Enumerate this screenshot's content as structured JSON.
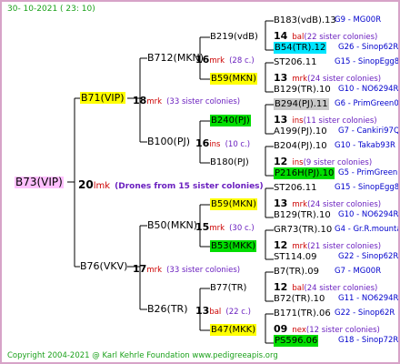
{
  "date": "30- 10-2021 ( 23: 10)",
  "copyright": "Copyright 2004-2021 @ Karl Kehrle Foundation   www.pedigreeapis.org",
  "colors": {
    "yellow": "#ffff00",
    "green": "#00dd00",
    "cyan": "#00e5ff",
    "gray": "#c8c8c8",
    "pink": "#ffc0ff",
    "lines": "#000000",
    "border": "#d7a3c8"
  },
  "root": {
    "name": "B73(VIP)",
    "num": "20",
    "mrk": "lmk",
    "colonies": "(Drones from 15 sister colonies)"
  },
  "gen1": [
    {
      "name": "B71(VIP)",
      "num": "18",
      "mrk": "mrk",
      "colonies": "(33 sister colonies)"
    },
    {
      "name": "B76(VKV)",
      "num": "17",
      "mrk": "mrk",
      "colonies": "(33 sister colonies)"
    }
  ],
  "gen2": [
    {
      "name": "B712(MKN)",
      "num": "16",
      "mrk": "mrk",
      "colonies": "(28 c.)"
    },
    {
      "name": "B100(PJ)",
      "num": "16",
      "mrk": "ins",
      "colonies": "(10 c.)"
    },
    {
      "name": "B50(MKN)",
      "num": "15",
      "mrk": "mrk",
      "colonies": "(30 c.)"
    },
    {
      "name": "B26(TR)",
      "num": "13",
      "mrk": "bal",
      "colonies": "(22 c.)"
    }
  ],
  "gen3": [
    {
      "name": "B219(vdB)"
    },
    {
      "name": "B59(MKN)"
    },
    {
      "name": "B240(PJ)"
    },
    {
      "name": "B180(PJ)"
    },
    {
      "name": "B59(MKN)"
    },
    {
      "name": "B53(MKK)"
    },
    {
      "name": "B77(TR)"
    },
    {
      "name": "B47(MKK)"
    }
  ],
  "gen4": [
    {
      "sire": "B183(vdB).13",
      "sire_code": "G9 - MG00R",
      "num": "14",
      "mrk": "bal",
      "colonies": "(22 sister colonies)",
      "dam": "B54(TR).12",
      "dam_code": "G26 - Sinop62R"
    },
    {
      "sire": "ST206.11",
      "sire_code": "G15 - SinopEgg86R",
      "num": "13",
      "mrk": "mrk",
      "colonies": "(24 sister colonies)",
      "dam": "B129(TR).10",
      "dam_code": "G10 - NO6294R"
    },
    {
      "sire": "B294(PJ).11",
      "sire_code": "G6 - PrimGreen00",
      "num": "13",
      "mrk": "ins",
      "colonies": "(11 sister colonies)",
      "dam": "A199(PJ).10",
      "dam_code": "G7 - Cankiri97Q"
    },
    {
      "sire": "B204(PJ).10",
      "sire_code": "G10 - Takab93R",
      "num": "12",
      "mrk": "ins",
      "colonies": "(9 sister colonies)",
      "dam": "P216H(PJ).10",
      "dam_code": "G5 - PrimGreen00"
    },
    {
      "sire": "ST206.11",
      "sire_code": "G15 - SinopEgg86R",
      "num": "13",
      "mrk": "mrk",
      "colonies": "(24 sister colonies)",
      "dam": "B129(TR).10",
      "dam_code": "G10 - NO6294R"
    },
    {
      "sire": "GR73(TR).10",
      "sire_code": "G4 - Gr.R.mounta",
      "num": "12",
      "mrk": "mrk",
      "colonies": "(21 sister colonies)",
      "dam": "ST114.09",
      "dam_code": "G22 - Sinop62R"
    },
    {
      "sire": "B7(TR).09",
      "sire_code": "G7 - MG00R",
      "num": "12",
      "mrk": "bal",
      "colonies": "(24 sister colonies)",
      "dam": "B72(TR).10",
      "dam_code": "G11 - NO6294R"
    },
    {
      "sire": "B171(TR).06",
      "sire_code": "G22 - Sinop62R",
      "num": "09",
      "mrk": "nex",
      "colonies": "(12 sister colonies)",
      "dam": "PS596.06",
      "dam_code": "G18 - Sinop72R"
    }
  ]
}
